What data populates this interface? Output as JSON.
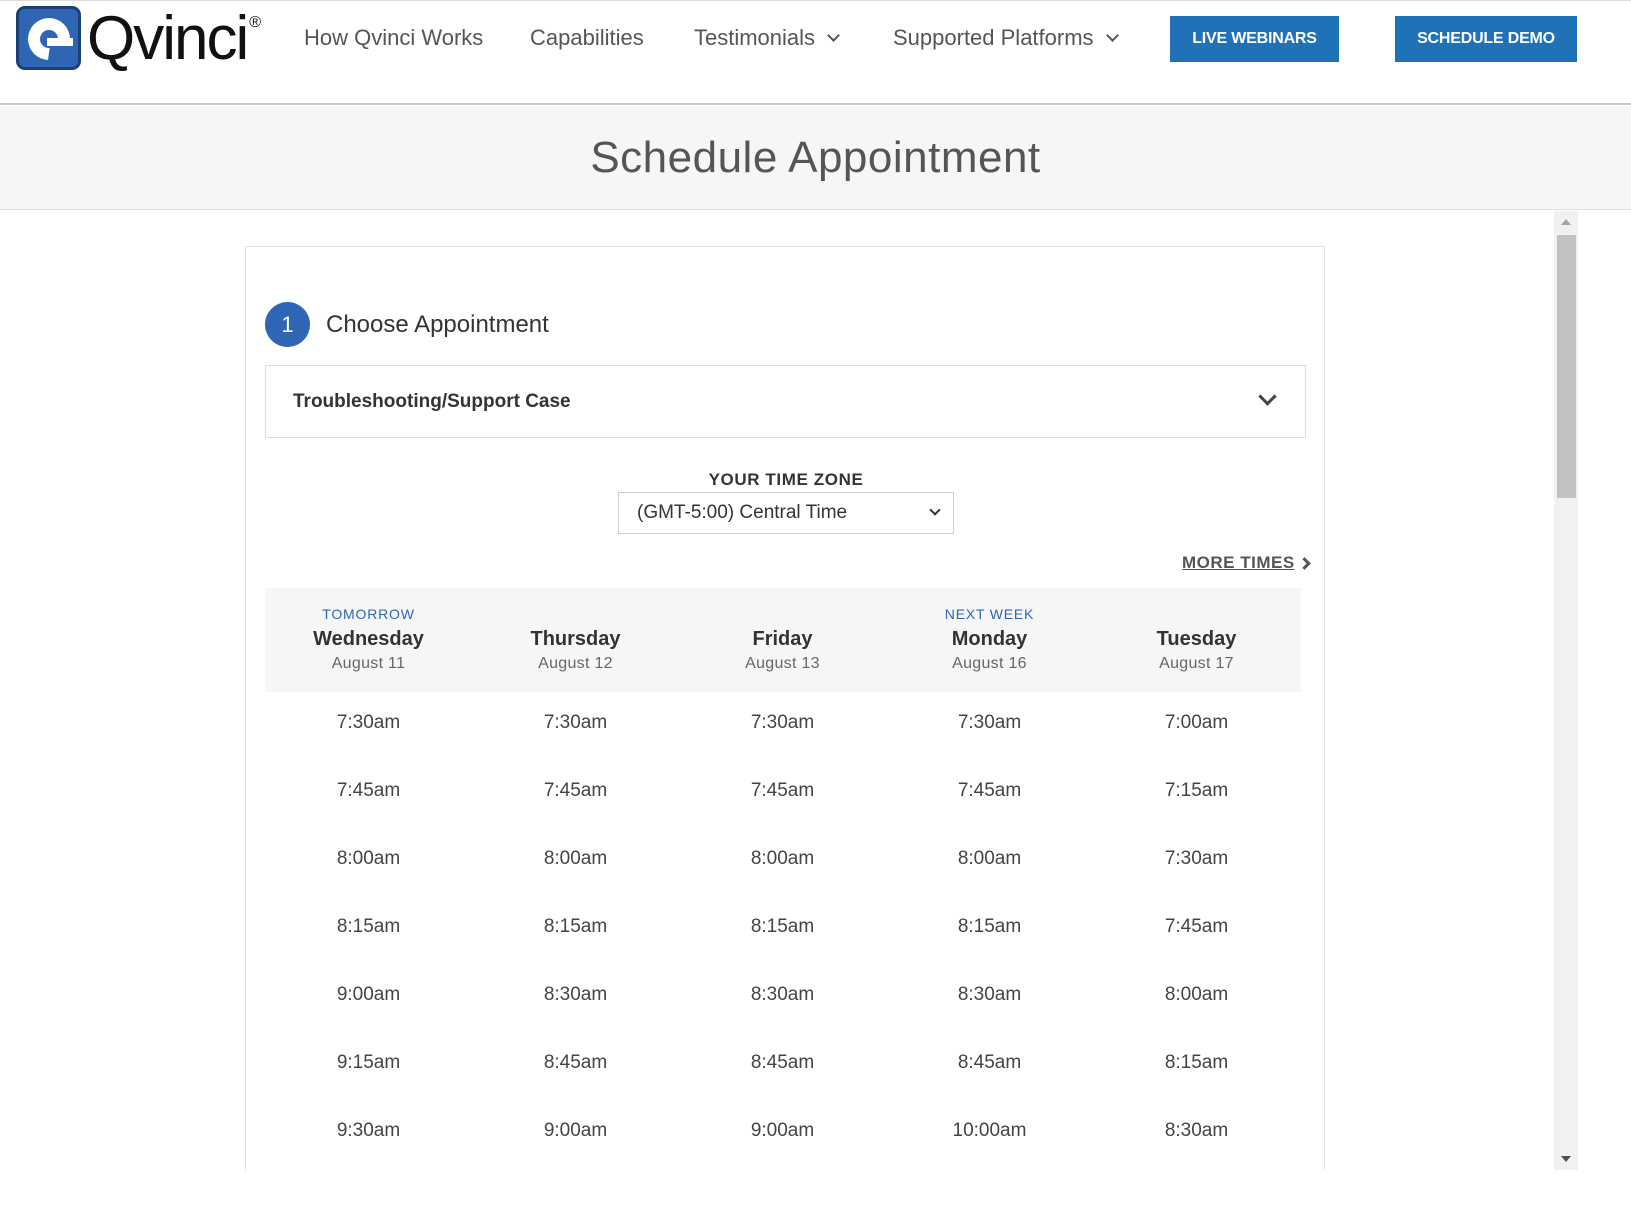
{
  "header": {
    "logo_text": "Qvinci",
    "logo_mark": "®",
    "nav": [
      {
        "label": "How Qvinci Works",
        "dropdown": false
      },
      {
        "label": "Capabilities",
        "dropdown": false
      },
      {
        "label": "Testimonials",
        "dropdown": true
      },
      {
        "label": "Supported Platforms",
        "dropdown": true
      }
    ],
    "webinars_label": "LIVE WEBINARS",
    "demo_label": "SCHEDULE DEMO"
  },
  "page_title": "Schedule Appointment",
  "step": {
    "number": "1",
    "label": "Choose Appointment"
  },
  "appointment_type": "Troubleshooting/Support Case",
  "timezone": {
    "label": "YOUR TIME ZONE",
    "value": "(GMT-5:00) Central Time"
  },
  "more_times_label": "MORE TIMES",
  "days": [
    {
      "tag": "TOMORROW",
      "name": "Wednesday",
      "date": "August 11",
      "slots": [
        "7:30am",
        "7:45am",
        "8:00am",
        "8:15am",
        "9:00am",
        "9:15am",
        "9:30am"
      ]
    },
    {
      "tag": "",
      "name": "Thursday",
      "date": "August 12",
      "slots": [
        "7:30am",
        "7:45am",
        "8:00am",
        "8:15am",
        "8:30am",
        "8:45am",
        "9:00am"
      ]
    },
    {
      "tag": "",
      "name": "Friday",
      "date": "August 13",
      "slots": [
        "7:30am",
        "7:45am",
        "8:00am",
        "8:15am",
        "8:30am",
        "8:45am",
        "9:00am"
      ]
    },
    {
      "tag": "NEXT WEEK",
      "name": "Monday",
      "date": "August 16",
      "slots": [
        "7:30am",
        "7:45am",
        "8:00am",
        "8:15am",
        "8:30am",
        "8:45am",
        "10:00am"
      ]
    },
    {
      "tag": "",
      "name": "Tuesday",
      "date": "August 17",
      "slots": [
        "7:00am",
        "7:15am",
        "7:30am",
        "7:45am",
        "8:00am",
        "8:15am",
        "8:30am"
      ]
    }
  ],
  "colors": {
    "brand_blue": "#2f66b3",
    "button_blue": "#1f72b8",
    "band_gray": "#f6f6f6"
  }
}
